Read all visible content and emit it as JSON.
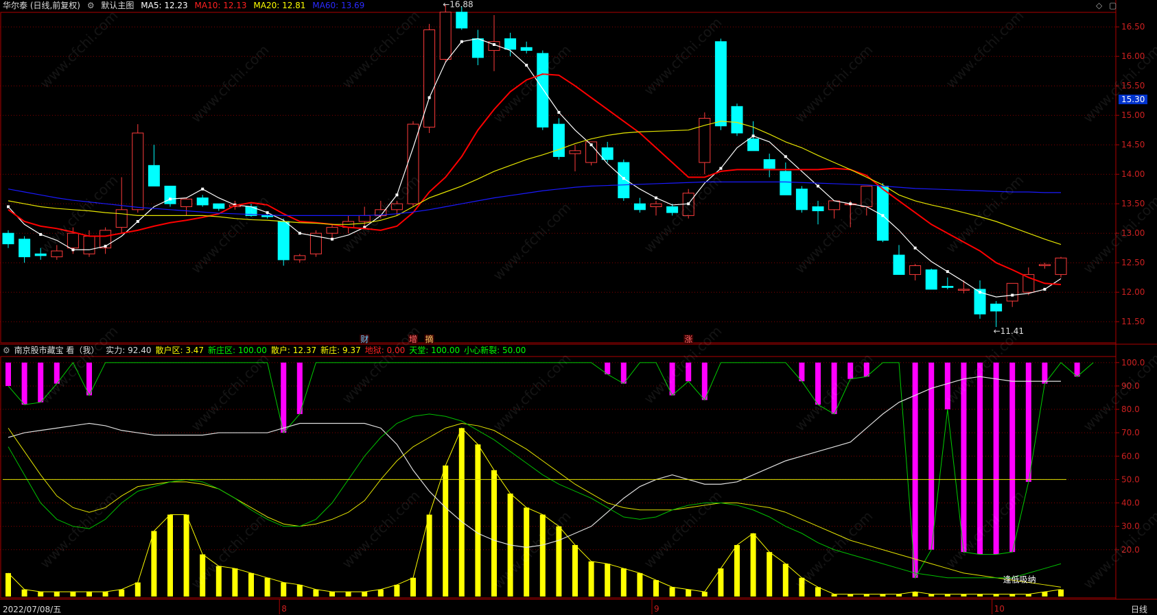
{
  "header": {
    "stock": "华尔泰 (日线,前复权)",
    "template": "默认主图",
    "ma5": "MA5: 12.23",
    "ma10": "MA10: 12.13",
    "ma20": "MA20: 12.81",
    "ma60": "MA60: 13.69"
  },
  "sub_header": {
    "indicator": "南京股市藏宝  看（我）",
    "items": [
      {
        "text": "实力: 92.40",
        "color": "#dddddd"
      },
      {
        "text": "散户区: 3.47",
        "color": "#ffff00"
      },
      {
        "text": "新庄区: 100.00",
        "color": "#00ff00"
      },
      {
        "text": "散户: 12.37",
        "color": "#ffff00"
      },
      {
        "text": "新庄: 9.37",
        "color": "#ffff00"
      },
      {
        "text": "地狱: 0.00",
        "color": "#ff2020"
      },
      {
        "text": "天堂: 100.00",
        "color": "#00ff00"
      },
      {
        "text": "小心新裂: 50.00",
        "color": "#00ff00"
      }
    ]
  },
  "current_price": "15.30",
  "bottom": {
    "date": "2022/07/08/五",
    "period": "日线",
    "month_marks": [
      "8",
      "9",
      "10"
    ]
  },
  "watermark": "www.cfchi.com",
  "colors": {
    "up": "#ff3b3b",
    "down": "#00ffff",
    "ma5": "#ffffff",
    "ma10": "#ff0000",
    "ma20": "#e6e600",
    "ma60": "#1a1aff"
  },
  "chart_data": [
    {
      "type": "candlestick",
      "title": "华尔泰 (日线,前复权)",
      "ylim": [
        11.2,
        16.7
      ],
      "yticks": [
        "16.50",
        "16.00",
        "15.50",
        "15.00",
        "14.50",
        "14.00",
        "13.50",
        "13.00",
        "12.50",
        "12.00",
        "11.50"
      ],
      "annotations": {
        "high": "16.88",
        "low": "11.41"
      },
      "events": [
        {
          "index": 22,
          "label": "财"
        },
        {
          "index": 25,
          "label": "增"
        },
        {
          "index": 26,
          "label": "摘"
        },
        {
          "index": 42,
          "label": "涨"
        }
      ],
      "ohlc": [
        [
          13.0,
          13.05,
          12.75,
          12.82
        ],
        [
          12.9,
          12.95,
          12.5,
          12.6
        ],
        [
          12.65,
          12.75,
          12.55,
          12.62
        ],
        [
          12.6,
          12.8,
          12.55,
          12.7
        ],
        [
          12.75,
          13.1,
          12.65,
          13.0
        ],
        [
          12.65,
          13.05,
          12.6,
          12.95
        ],
        [
          12.75,
          13.1,
          12.65,
          13.05
        ],
        [
          13.1,
          13.95,
          13.0,
          13.4
        ],
        [
          13.4,
          14.85,
          13.35,
          14.7
        ],
        [
          14.15,
          14.5,
          13.8,
          13.8
        ],
        [
          13.8,
          13.8,
          13.45,
          13.5
        ],
        [
          13.45,
          13.6,
          13.3,
          13.58
        ],
        [
          13.6,
          13.65,
          13.45,
          13.48
        ],
        [
          13.5,
          13.5,
          13.38,
          13.42
        ],
        [
          13.45,
          13.55,
          13.4,
          13.48
        ],
        [
          13.45,
          13.5,
          13.28,
          13.3
        ],
        [
          13.3,
          13.35,
          13.25,
          13.28
        ],
        [
          13.2,
          13.25,
          12.45,
          12.55
        ],
        [
          12.55,
          12.65,
          12.5,
          12.62
        ],
        [
          12.65,
          13.05,
          12.6,
          13.0
        ],
        [
          13.0,
          13.15,
          12.9,
          13.1
        ],
        [
          13.1,
          13.3,
          13.0,
          13.2
        ],
        [
          13.2,
          13.45,
          13.1,
          13.3
        ],
        [
          13.3,
          13.55,
          13.25,
          13.4
        ],
        [
          13.4,
          13.55,
          13.3,
          13.5
        ],
        [
          13.5,
          14.9,
          13.45,
          14.85
        ],
        [
          14.8,
          16.55,
          14.7,
          16.45
        ],
        [
          15.95,
          16.88,
          15.9,
          16.75
        ],
        [
          16.75,
          16.85,
          16.45,
          16.48
        ],
        [
          16.3,
          16.45,
          15.85,
          15.98
        ],
        [
          16.1,
          16.7,
          15.75,
          16.25
        ],
        [
          16.3,
          16.4,
          16.0,
          16.12
        ],
        [
          16.15,
          16.25,
          16.05,
          16.1
        ],
        [
          16.05,
          16.1,
          14.75,
          14.8
        ],
        [
          14.85,
          14.95,
          14.25,
          14.3
        ],
        [
          14.35,
          14.5,
          14.05,
          14.4
        ],
        [
          14.2,
          14.55,
          14.15,
          14.55
        ],
        [
          14.45,
          14.55,
          14.2,
          14.25
        ],
        [
          14.2,
          14.25,
          13.55,
          13.6
        ],
        [
          13.5,
          13.6,
          13.35,
          13.4
        ],
        [
          13.45,
          13.55,
          13.3,
          13.5
        ],
        [
          13.45,
          13.5,
          13.3,
          13.35
        ],
        [
          13.3,
          13.75,
          13.25,
          13.68
        ],
        [
          14.2,
          15.05,
          14.0,
          14.95
        ],
        [
          16.25,
          16.3,
          14.75,
          14.82
        ],
        [
          15.15,
          15.2,
          14.65,
          14.7
        ],
        [
          14.6,
          14.9,
          14.4,
          14.4
        ],
        [
          14.25,
          14.35,
          13.95,
          14.1
        ],
        [
          14.05,
          14.2,
          13.65,
          13.65
        ],
        [
          13.75,
          13.8,
          13.35,
          13.4
        ],
        [
          13.45,
          13.55,
          13.15,
          13.38
        ],
        [
          13.4,
          13.55,
          13.25,
          13.55
        ],
        [
          13.5,
          13.55,
          13.1,
          13.5
        ],
        [
          13.45,
          13.8,
          13.3,
          13.8
        ],
        [
          13.8,
          13.85,
          12.85,
          12.88
        ],
        [
          12.63,
          12.8,
          12.3,
          12.3
        ],
        [
          12.3,
          12.48,
          12.2,
          12.45
        ],
        [
          12.38,
          12.4,
          12.05,
          12.05
        ],
        [
          12.1,
          12.25,
          12.05,
          12.08
        ],
        [
          12.05,
          12.2,
          11.98,
          12.05
        ],
        [
          12.05,
          12.2,
          11.55,
          11.63
        ],
        [
          11.8,
          11.85,
          11.41,
          11.68
        ],
        [
          11.85,
          12.1,
          11.75,
          12.15
        ],
        [
          12.0,
          12.42,
          11.95,
          12.3
        ],
        [
          12.45,
          12.5,
          12.4,
          12.47
        ],
        [
          12.3,
          12.6,
          12.25,
          12.58
        ]
      ],
      "series": [
        {
          "name": "MA5",
          "values": [
            13.45,
            13.15,
            12.98,
            12.88,
            12.72,
            12.72,
            12.78,
            12.95,
            13.2,
            13.45,
            13.58,
            13.6,
            13.75,
            13.6,
            13.48,
            13.45,
            13.35,
            13.22,
            13.0,
            12.95,
            12.9,
            12.97,
            13.1,
            13.3,
            13.65,
            14.45,
            15.3,
            15.9,
            16.25,
            16.3,
            16.2,
            16.1,
            15.85,
            15.45,
            15.05,
            14.75,
            14.5,
            14.18,
            13.93,
            13.75,
            13.6,
            13.48,
            13.5,
            13.85,
            14.1,
            14.45,
            14.65,
            14.55,
            14.3,
            14.05,
            13.8,
            13.55,
            13.5,
            13.45,
            13.3,
            13.05,
            12.75,
            12.52,
            12.35,
            12.18,
            12.0,
            11.92,
            11.95,
            11.98,
            12.05,
            12.23
          ]
        },
        {
          "name": "MA10",
          "values": [
            13.4,
            13.2,
            13.12,
            13.08,
            13.02,
            12.95,
            12.95,
            13.0,
            13.05,
            13.12,
            13.18,
            13.22,
            13.27,
            13.33,
            13.47,
            13.52,
            13.48,
            13.33,
            13.2,
            13.18,
            13.15,
            13.1,
            13.08,
            13.05,
            13.12,
            13.35,
            13.7,
            13.95,
            14.3,
            14.75,
            15.1,
            15.4,
            15.6,
            15.7,
            15.68,
            15.5,
            15.3,
            15.1,
            14.9,
            14.7,
            14.45,
            14.2,
            13.95,
            13.95,
            14.05,
            14.08,
            14.08,
            14.08,
            14.08,
            14.08,
            14.08,
            14.1,
            14.08,
            13.98,
            13.75,
            13.55,
            13.35,
            13.15,
            13.0,
            12.85,
            12.7,
            12.5,
            12.38,
            12.25,
            12.15,
            12.13
          ]
        },
        {
          "name": "MA20",
          "values": [
            13.55,
            13.5,
            13.45,
            13.42,
            13.4,
            13.38,
            13.35,
            13.33,
            13.3,
            13.3,
            13.3,
            13.3,
            13.3,
            13.28,
            13.25,
            13.23,
            13.22,
            13.2,
            13.18,
            13.17,
            13.15,
            13.15,
            13.17,
            13.22,
            13.3,
            13.45,
            13.6,
            13.7,
            13.8,
            13.92,
            14.05,
            14.15,
            14.25,
            14.33,
            14.42,
            14.52,
            14.6,
            14.66,
            14.7,
            14.72,
            14.73,
            14.74,
            14.75,
            14.83,
            14.9,
            14.88,
            14.8,
            14.68,
            14.55,
            14.45,
            14.32,
            14.2,
            14.08,
            13.95,
            13.82,
            13.65,
            13.55,
            13.48,
            13.42,
            13.35,
            13.28,
            13.2,
            13.1,
            13.0,
            12.9,
            12.81
          ]
        },
        {
          "name": "MA60",
          "values": [
            13.75,
            13.7,
            13.65,
            13.6,
            13.56,
            13.53,
            13.5,
            13.47,
            13.44,
            13.42,
            13.4,
            13.38,
            13.36,
            13.34,
            13.33,
            13.32,
            13.31,
            13.3,
            13.3,
            13.3,
            13.3,
            13.3,
            13.3,
            13.31,
            13.33,
            13.36,
            13.4,
            13.45,
            13.5,
            13.55,
            13.6,
            13.64,
            13.68,
            13.72,
            13.75,
            13.78,
            13.8,
            13.81,
            13.82,
            13.83,
            13.84,
            13.85,
            13.86,
            13.87,
            13.87,
            13.87,
            13.87,
            13.87,
            13.87,
            13.86,
            13.85,
            13.84,
            13.83,
            13.82,
            13.8,
            13.78,
            13.76,
            13.75,
            13.74,
            13.73,
            13.72,
            13.71,
            13.7,
            13.7,
            13.69,
            13.69
          ]
        }
      ]
    },
    {
      "type": "bar",
      "title": "南京股市藏宝 看（我）",
      "ylim": [
        0,
        102
      ],
      "yticks": [
        "100.0",
        "90.0",
        "80.0",
        "70.0",
        "60.0",
        "50.0",
        "40.0",
        "30.0",
        "20.0"
      ],
      "annotations": {
        "label": "逢低吸纳"
      },
      "series": [
        {
          "name": "散户",
          "values": [
            10,
            3,
            2,
            2,
            2,
            2,
            2,
            3,
            6,
            28,
            35,
            35,
            18,
            13,
            12,
            10,
            8,
            6,
            5,
            3,
            2,
            2,
            2,
            3,
            5,
            8,
            35,
            56,
            72,
            65,
            54,
            44,
            38,
            35,
            30,
            22,
            15,
            14,
            12,
            10,
            7,
            4,
            3,
            2,
            12,
            22,
            27,
            19,
            14,
            8,
            4,
            1,
            1,
            1,
            1,
            1,
            2,
            1,
            1,
            1,
            1,
            1,
            1,
            1,
            2,
            3
          ]
        },
        {
          "name": "新庄",
          "values": [
            90,
            82,
            83,
            91,
            100,
            86,
            100,
            100,
            100,
            100,
            100,
            100,
            100,
            100,
            100,
            100,
            100,
            70,
            78,
            100,
            100,
            100,
            100,
            100,
            100,
            100,
            100,
            100,
            100,
            100,
            100,
            100,
            100,
            100,
            100,
            100,
            100,
            95,
            91,
            100,
            100,
            86,
            92,
            84,
            100,
            100,
            100,
            100,
            100,
            92,
            82,
            78,
            93,
            94,
            100,
            100,
            8,
            20,
            80,
            19,
            18,
            18,
            19,
            49,
            91,
            100,
            94,
            100
          ]
        },
        {
          "name": "实力",
          "values": [
            68,
            70,
            71,
            72,
            73,
            74,
            73,
            71,
            70,
            69,
            69,
            69,
            69,
            70,
            70,
            70,
            70,
            72,
            74,
            74,
            74,
            74,
            74,
            72,
            65,
            54,
            45,
            38,
            32,
            27,
            24,
            22,
            21,
            22,
            24,
            27,
            30,
            36,
            42,
            47,
            50,
            52,
            50,
            48,
            48,
            49,
            52,
            55,
            58,
            60,
            62,
            64,
            66,
            72,
            78,
            83,
            86,
            89,
            91,
            93,
            94,
            93,
            92,
            92,
            92,
            92
          ]
        },
        {
          "name": "小心新裂",
          "values": [
            50
          ]
        }
      ]
    }
  ]
}
